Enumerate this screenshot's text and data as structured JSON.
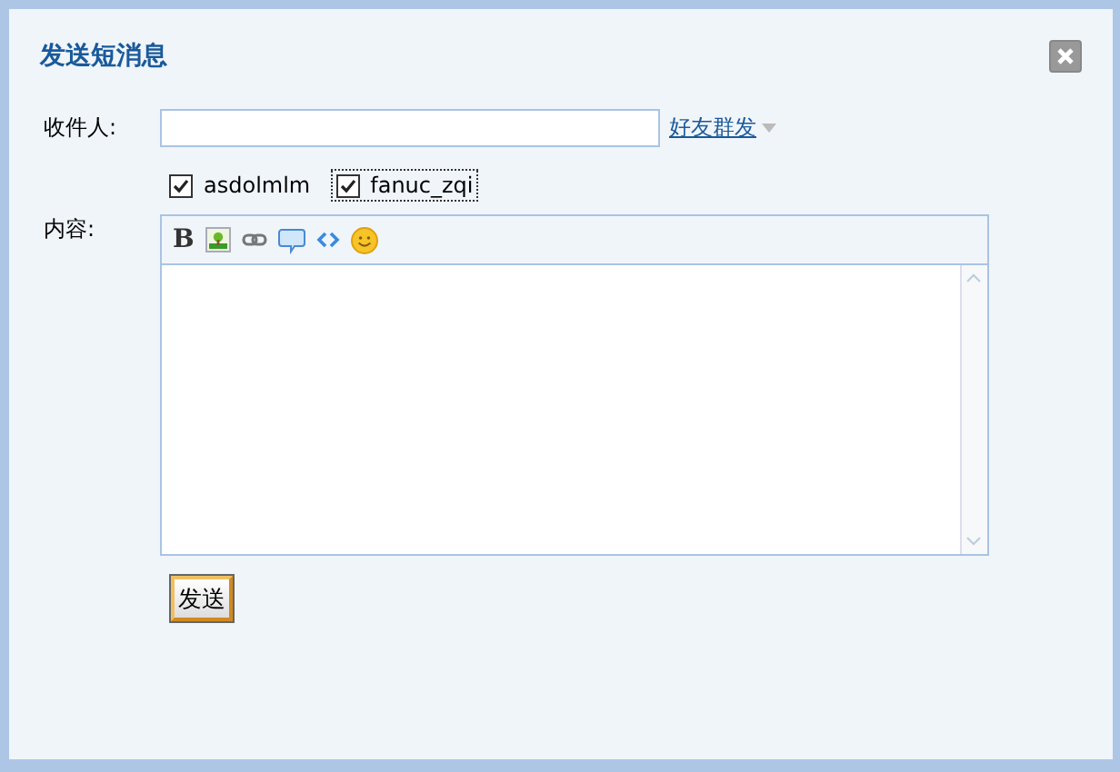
{
  "dialog": {
    "title": "发送短消息"
  },
  "recipient": {
    "label": "收件人:",
    "link": "好友群发"
  },
  "friends": [
    {
      "name": "asdolmlm",
      "checked": true,
      "focused": false
    },
    {
      "name": "fanuc_zqi",
      "checked": true,
      "focused": true
    }
  ],
  "content": {
    "label": "内容:"
  },
  "toolbar": [
    {
      "kind": "bold",
      "label": "B"
    },
    {
      "kind": "image"
    },
    {
      "kind": "link"
    },
    {
      "kind": "quote"
    },
    {
      "kind": "code"
    },
    {
      "kind": "smiley"
    }
  ],
  "send_button": "发送"
}
